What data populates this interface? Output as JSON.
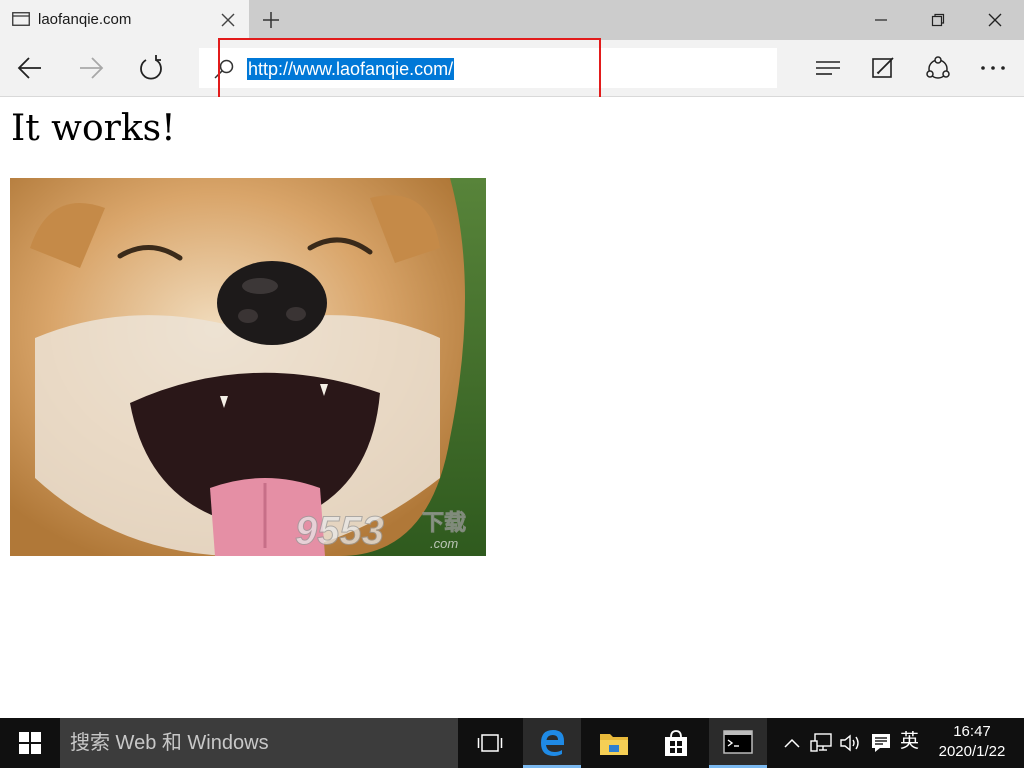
{
  "browser": {
    "tab": {
      "title": "laofanqie.com",
      "icon": "page-icon"
    },
    "address": {
      "url": "http://www.laofanqie.com/",
      "icon": "search-icon"
    },
    "toolbar_icons": [
      "back-arrow-icon",
      "forward-arrow-icon",
      "refresh-icon",
      "hub-icon",
      "web-note-icon",
      "share-icon",
      "more-icon"
    ],
    "window_controls": [
      "minimize-icon",
      "restore-icon",
      "close-icon"
    ],
    "selection_color": "#0078d7"
  },
  "annotation": {
    "color": "#e21b1b"
  },
  "page": {
    "heading": "It works!",
    "image": {
      "subject": "smiling-shiba-dog",
      "watermark": "9553下载 .com"
    }
  },
  "taskbar": {
    "search_placeholder": "搜索 Web 和 Windows",
    "apps": [
      "task-view-icon",
      "edge-icon",
      "file-explorer-icon",
      "store-icon",
      "cmd-icon"
    ],
    "tray": [
      "chevron-up-icon",
      "network-icon",
      "volume-icon",
      "action-center-icon"
    ],
    "ime": "英",
    "time": "16:47",
    "date": "2020/1/22"
  }
}
